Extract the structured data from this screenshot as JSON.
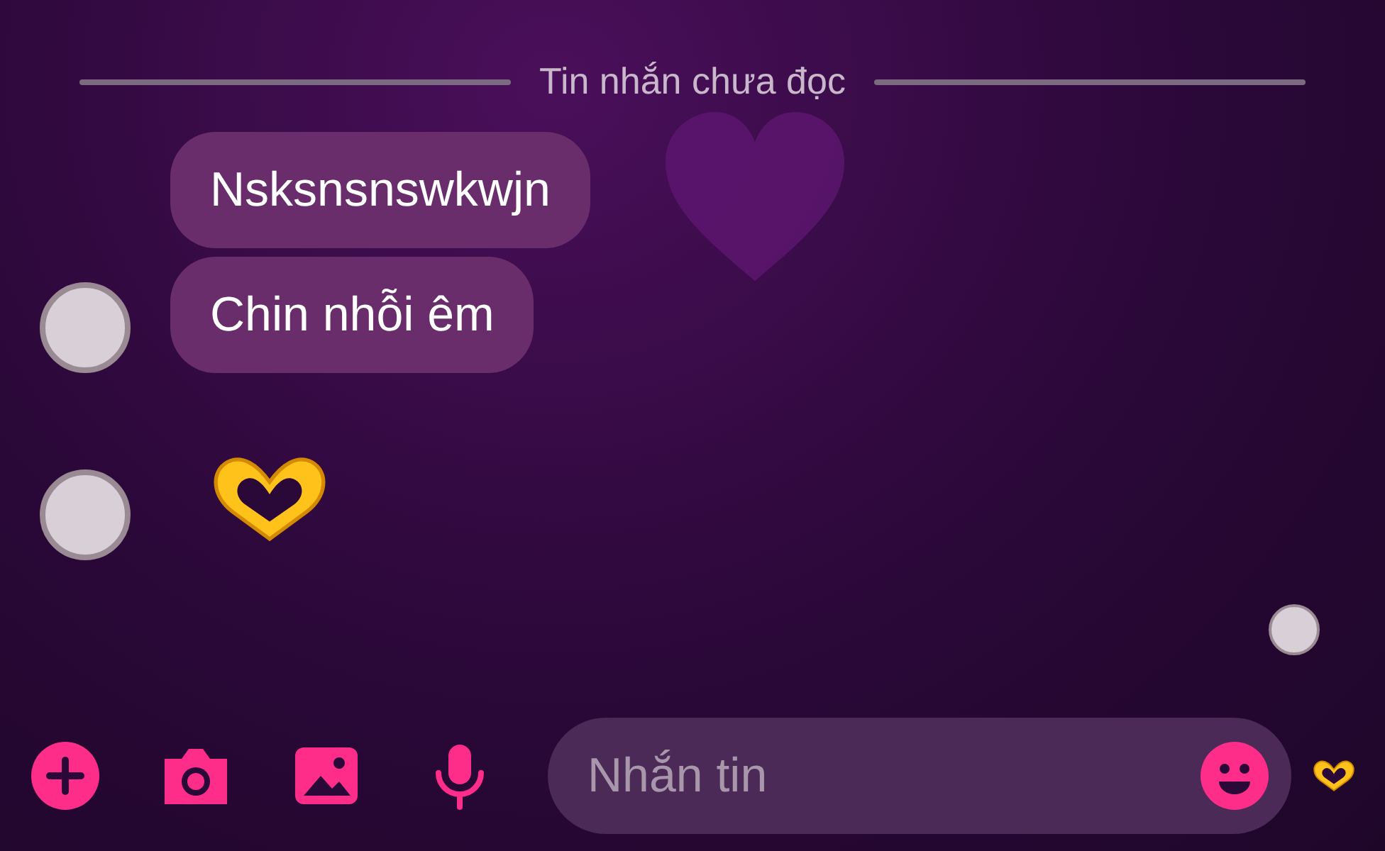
{
  "divider": {
    "label": "Tin nhắn chưa đọc"
  },
  "messages": [
    {
      "kind": "text",
      "text": "Nsksnsnswkwjn",
      "avatar": false
    },
    {
      "kind": "text",
      "text": "Chin nhỗi êm",
      "avatar": true
    },
    {
      "kind": "sticker",
      "avatar": true
    }
  ],
  "composer": {
    "placeholder": "Nhắn tin"
  }
}
